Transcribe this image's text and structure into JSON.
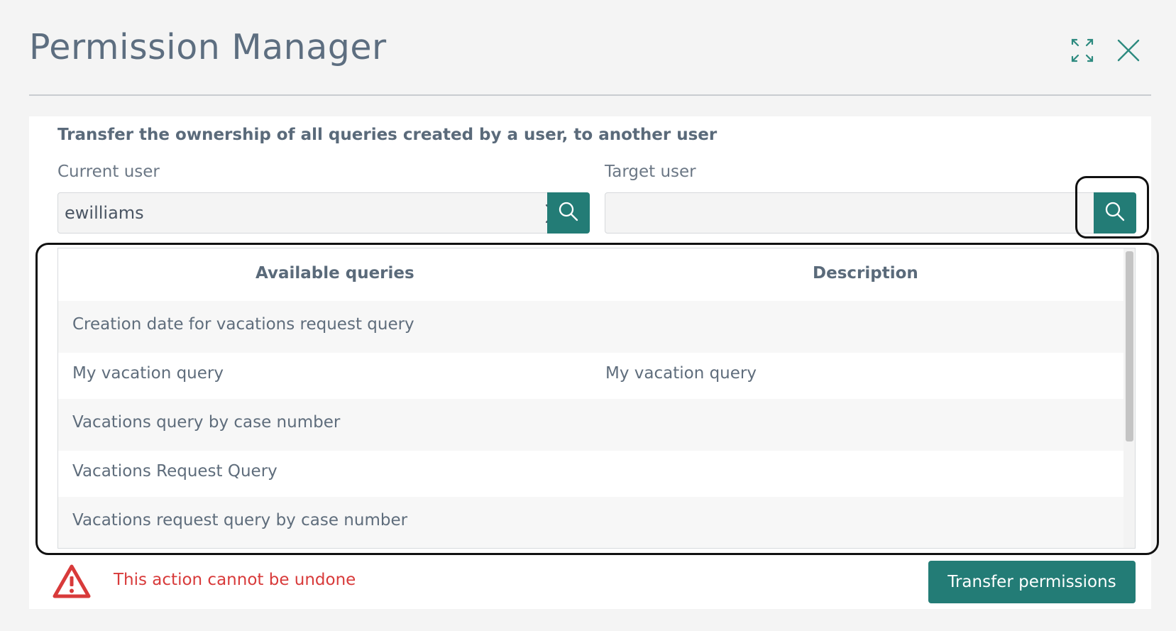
{
  "header": {
    "title": "Permission Manager",
    "icons": [
      "expand-icon",
      "close-icon"
    ],
    "accent_color": "#237c76"
  },
  "panel": {
    "subtitle": "Transfer the ownership of all queries created by a user, to another user",
    "current_user": {
      "label": "Current user",
      "value": "ewilliams",
      "placeholder": ""
    },
    "target_user": {
      "label": "Target user",
      "value": "",
      "placeholder": ""
    },
    "table": {
      "columns": [
        "Available queries",
        "Description"
      ],
      "rows": [
        {
          "query": "Creation date for vacations request query",
          "description": ""
        },
        {
          "query": "My vacation query",
          "description": "My vacation query"
        },
        {
          "query": "Vacations query by case number",
          "description": ""
        },
        {
          "query": "Vacations Request Query",
          "description": ""
        },
        {
          "query": "Vacations request query by case number",
          "description": ""
        }
      ]
    },
    "warning": {
      "text": "This action cannot be undone",
      "color": "#d83a3a"
    },
    "transfer_button_label": "Transfer permissions"
  }
}
